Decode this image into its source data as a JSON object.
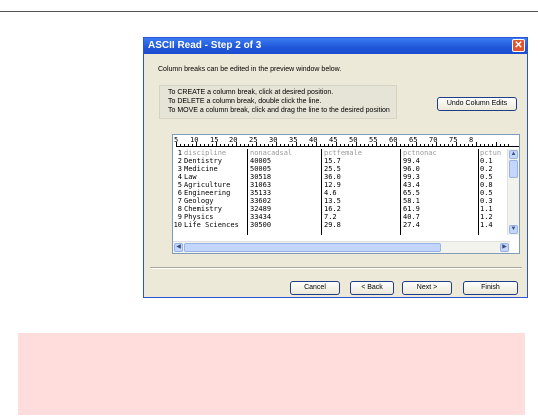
{
  "dialog": {
    "title": "ASCII Read - Step 2 of 3",
    "intro": "Column breaks can be edited in the preview window below.",
    "instructions": [
      "To CREATE a column break, click at desired position.",
      "To DELETE a column break, double click the line.",
      "To MOVE a column break, click and drag the line to the desired position"
    ],
    "undo_label": "Undo Column Edits",
    "buttons": {
      "cancel": "Cancel",
      "back": "< Back",
      "next": "Next >",
      "finish": "Finish"
    }
  },
  "preview": {
    "ruler": [
      "5",
      "10",
      "15",
      "20",
      "25",
      "30",
      "35",
      "40",
      "45",
      "50",
      "55",
      "60",
      "65",
      "70",
      "75",
      "8"
    ],
    "rows": [
      {
        "n": "1",
        "cells": [
          "discipline",
          "nonacadsal",
          "pctfemale",
          "pctnonac",
          "pctun"
        ],
        "header": true
      },
      {
        "n": "2",
        "cells": [
          "Dentistry",
          "40005",
          "15.7",
          "99.4",
          "0.1"
        ]
      },
      {
        "n": "3",
        "cells": [
          "Medicine",
          "50005",
          "25.5",
          "96.0",
          "0.2"
        ]
      },
      {
        "n": "4",
        "cells": [
          "Law",
          "30518",
          "36.0",
          "99.3",
          "0.5"
        ]
      },
      {
        "n": "5",
        "cells": [
          "Agriculture",
          "31063",
          "12.9",
          "43.4",
          "0.8"
        ]
      },
      {
        "n": "6",
        "cells": [
          "Engineering",
          "35133",
          "4.6",
          "65.5",
          "0.5"
        ]
      },
      {
        "n": "7",
        "cells": [
          "Geology",
          "33602",
          "13.5",
          "58.1",
          "0.3"
        ]
      },
      {
        "n": "8",
        "cells": [
          "Chemistry",
          "32489",
          "16.2",
          "61.9",
          "1.1"
        ]
      },
      {
        "n": "9",
        "cells": [
          "Physics",
          "33434",
          "7.2",
          "40.7",
          "1.2"
        ]
      },
      {
        "n": "10",
        "cells": [
          "Life Sciences",
          "30500",
          "29.8",
          "27.4",
          "1.4"
        ]
      }
    ]
  },
  "colors": {
    "titlebar": "#1f55d8",
    "dialog_bg": "#ece9d8",
    "notice_bg": "#ffdddd",
    "header_text": "#9a9a9a"
  }
}
